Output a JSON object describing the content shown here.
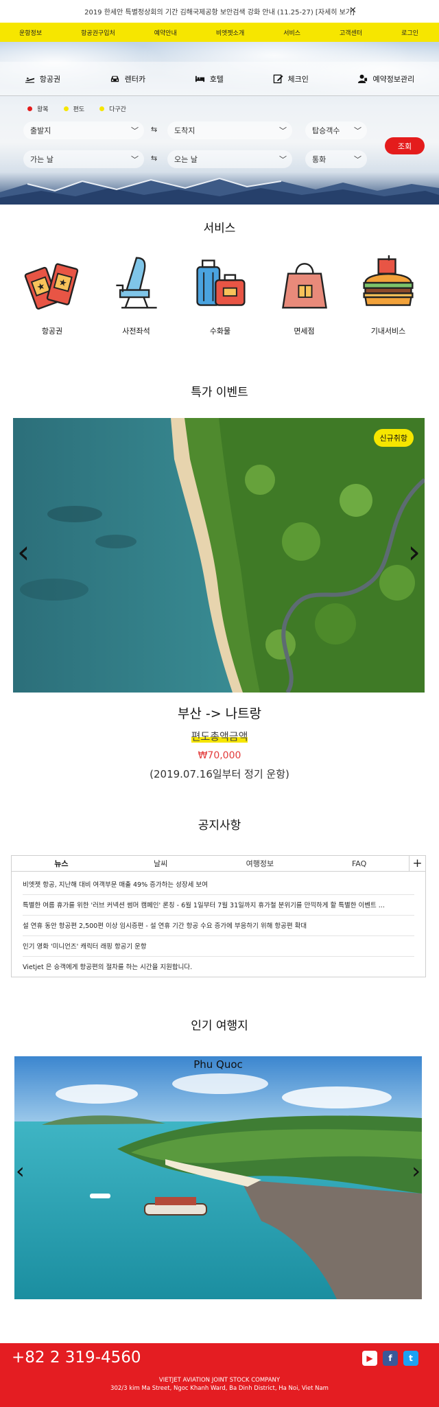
{
  "announcement": {
    "text": "2019 한세안 특별정상회의 기간 김해국제공항 보안검색 강화 안내 (11.25-27) [자세히 보기]",
    "close": "✕"
  },
  "nav": [
    "운항정보",
    "항공권구입처",
    "예약안내",
    "비엣젯소개",
    "서비스",
    "고객센터",
    "로그인"
  ],
  "booking": {
    "tabs": [
      "항공권",
      "렌터카",
      "호텔",
      "체크인",
      "예약정보관리"
    ],
    "trip_types": [
      {
        "label": "왕복",
        "color": "#e41c1c"
      },
      {
        "label": "편도",
        "color": "#f6e600"
      },
      {
        "label": "다구간",
        "color": "#f6e600"
      }
    ],
    "origin": "출발지",
    "destination": "도착지",
    "passengers": "탑승객수",
    "depart_date": "가는 날",
    "return_date": "오는 날",
    "currency": "통화",
    "search": "조회"
  },
  "services": {
    "title": "서비스",
    "items": [
      "항공권",
      "사전좌석",
      "수화물",
      "면세점",
      "기내서비스"
    ]
  },
  "event": {
    "title": "특가 이벤트",
    "badge": "신규취항",
    "route": "부산 -> 나트랑",
    "fare_label": "편도총액금액",
    "price": "₩70,000",
    "period": "(2019.07.16일부터 정기 운항)"
  },
  "notice": {
    "title": "공지사항",
    "tabs": [
      "뉴스",
      "날씨",
      "여행정보",
      "FAQ"
    ],
    "plus": "+",
    "items": [
      "비엣젯 항공, 지난해 대비 여객부문 매출 49% 증가하는 성장세 보여",
      "특별한 여름 휴가를 위한 '러브 커넥션 썸머 캠페인' 론칭 - 6월 1일부터 7월 31일까지 휴가철 분위기를 만끽하게 할 특별한 이벤트 ...",
      "설 연휴 동안 항공편 2,500편 이상 임시증편 - 설 연휴 기간 항공 수요 증가에 부응하기 위해 항공편 확대",
      "인기 영화 '미니언즈' 캐릭터 래핑 항공기 운항",
      "Vietjet 은 승객에게 항공편의 절차를 하는 시간을 지원합니다."
    ]
  },
  "destinations": {
    "title": "인기 여행지",
    "current": "Phu Quoc"
  },
  "footer": {
    "phone": "+82 2 319-4560",
    "company": "VIETJET AVIATION JOINT STOCK COMPANY",
    "address": "302/3 kim Ma Street, Ngoc Khanh Ward, Ba Dinh District, Ha Noi, Viet Nam",
    "social": [
      "youtube-icon",
      "facebook-icon",
      "twitter-icon"
    ]
  },
  "colors": {
    "brand_yellow": "#f6e600",
    "brand_red": "#e41d22"
  }
}
